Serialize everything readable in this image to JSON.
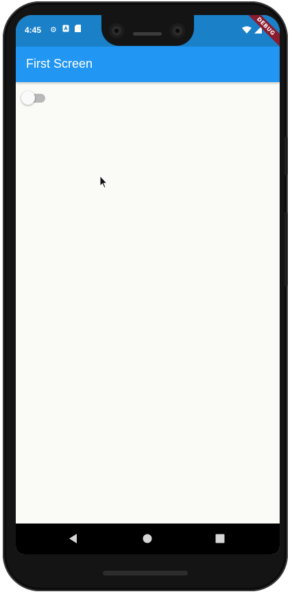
{
  "status_bar": {
    "time": "4:45",
    "icons": [
      "settings-icon",
      "a-icon",
      "sd-card-icon"
    ],
    "right_icons": [
      "wifi-icon",
      "signal-icon",
      "battery-icon"
    ],
    "debug_banner": "DEBUG"
  },
  "app_bar": {
    "title": "First Screen",
    "color": "#2196f3"
  },
  "body": {
    "switch": {
      "on": false
    }
  },
  "nav_bar": {
    "buttons": [
      "back-icon",
      "home-icon",
      "recents-icon"
    ]
  }
}
